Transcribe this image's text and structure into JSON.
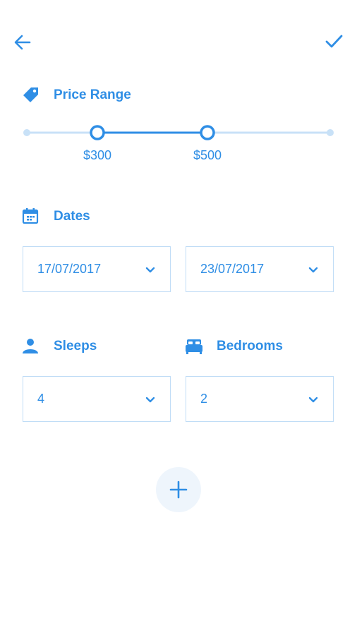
{
  "header": {
    "back_icon": "arrow-left-icon",
    "confirm_icon": "check-icon"
  },
  "price_range": {
    "title": "Price Range",
    "icon": "price-tag-icon",
    "min_label": "$300",
    "max_label": "$500"
  },
  "dates": {
    "title": "Dates",
    "icon": "calendar-icon",
    "start_value": "17/07/2017",
    "end_value": "23/07/2017"
  },
  "sleeps": {
    "title": "Sleeps",
    "icon": "person-icon",
    "value": "4"
  },
  "bedrooms": {
    "title": "Bedrooms",
    "icon": "bed-icon",
    "value": "2"
  },
  "add_button": {
    "icon": "plus-icon"
  },
  "colors": {
    "accent": "#2f8ee5",
    "track_light": "#c8e1f7",
    "border": "#bfdcf6",
    "fab_bg": "#eef5fc"
  }
}
